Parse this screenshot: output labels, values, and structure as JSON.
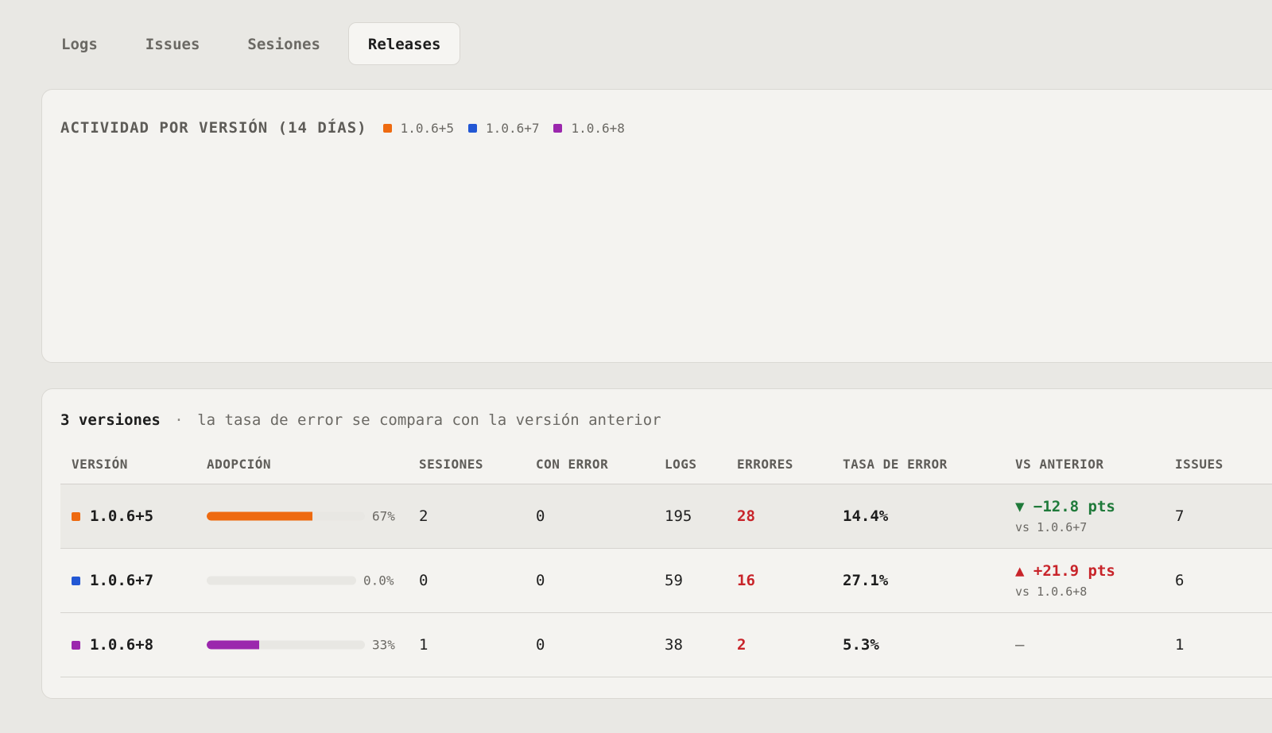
{
  "tabs": [
    {
      "label": "Logs",
      "active": false
    },
    {
      "label": "Issues",
      "active": false
    },
    {
      "label": "Sesiones",
      "active": false
    },
    {
      "label": "Releases",
      "active": true
    }
  ],
  "chart": {
    "title": "ACTIVIDAD POR VERSIÓN (14 DÍAS)",
    "legend": [
      {
        "label": "1.0.6+5",
        "color": "#ee6a10"
      },
      {
        "label": "1.0.6+7",
        "color": "#2257d4"
      },
      {
        "label": "1.0.6+8",
        "color": "#9b27ad"
      }
    ]
  },
  "table": {
    "count_label": "3 versiones",
    "separator": "·",
    "note": "la tasa de error se compara con la versión anterior",
    "headers": {
      "version": "VERSIÓN",
      "adoption": "ADOPCIÓN",
      "sessions": "SESIONES",
      "with_error": "CON ERROR",
      "logs": "LOGS",
      "errors": "ERRORES",
      "error_rate": "TASA DE ERROR",
      "vs_previous": "VS ANTERIOR",
      "issues": "ISSUES"
    },
    "rows": [
      {
        "version": "1.0.6+5",
        "color": "#ee6a10",
        "adoption": 0.67,
        "adoption_label": "67%",
        "sessions": "2",
        "with_error": "0",
        "logs": "195",
        "errors": "28",
        "error_rate": "14.4%",
        "vs_main": "▼ −12.8 pts",
        "vs_sub": "vs 1.0.6+7",
        "vs_trend": "down",
        "issues": "7"
      },
      {
        "version": "1.0.6+7",
        "color": "#2257d4",
        "adoption": 0.0,
        "adoption_label": "0.0%",
        "sessions": "0",
        "with_error": "0",
        "logs": "59",
        "errors": "16",
        "error_rate": "27.1%",
        "vs_main": "▲ +21.9 pts",
        "vs_sub": "vs 1.0.6+8",
        "vs_trend": "up",
        "issues": "6"
      },
      {
        "version": "1.0.6+8",
        "color": "#9b27ad",
        "adoption": 0.33,
        "adoption_label": "33%",
        "sessions": "1",
        "with_error": "0",
        "logs": "38",
        "errors": "2",
        "error_rate": "5.3%",
        "vs_main": "—",
        "vs_sub": "",
        "vs_trend": "none",
        "issues": "1"
      }
    ]
  }
}
